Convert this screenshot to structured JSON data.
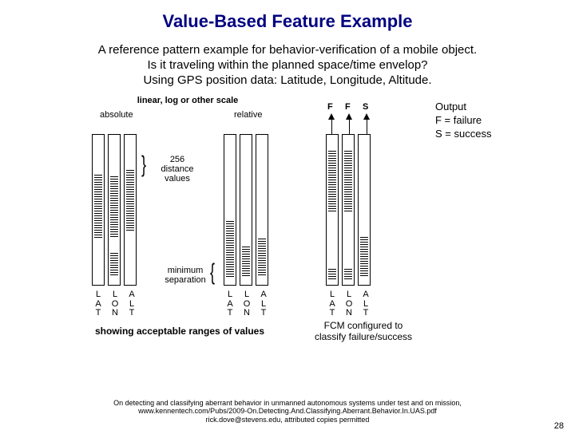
{
  "title": "Value-Based Feature Example",
  "subtitle_l1": "A reference pattern example for behavior-verification of a mobile object.",
  "subtitle_l2": "Is it traveling within the planned space/time envelop?",
  "subtitle_l3": "Using GPS position data: Latitude, Longitude, Altitude.",
  "scale_label": "linear, log or other scale",
  "abs_label": "absolute",
  "rel_label": "relative",
  "distance_l1": "256",
  "distance_l2": "distance",
  "distance_l3": "values",
  "minsep_l1": "minimum",
  "minsep_l2": "separation",
  "caption_left": "showing acceptable ranges of values",
  "caption_right_l1": "FCM configured to",
  "caption_right_l2": "classify failure/success",
  "out_F1": "F",
  "out_F2": "F",
  "out_S": "S",
  "output_l1": "Output",
  "output_l2": "F = failure",
  "output_l3": "S = success",
  "cols": {
    "a1": "L\nA\nT",
    "a2": "L\nO\nN",
    "a3": "A\nL\nT",
    "b1": "L\nA\nT",
    "b2": "L\nO\nN",
    "b3": "A\nL\nT",
    "c1": "L\nA\nT",
    "c2": "L\nO\nN",
    "c3": "A\nL\nT"
  },
  "footer_l1": "On detecting and classifying aberrant behavior in unmanned autonomous systems under test and on mission,",
  "footer_l2": "www.kennentech.com/Pubs/2009-On.Detecting.And.Classifying.Aberrant.Behavior.In.UAS.pdf",
  "footer_l3": "rick.dove@stevens.edu, attributed copies permitted",
  "pagenum": "28"
}
